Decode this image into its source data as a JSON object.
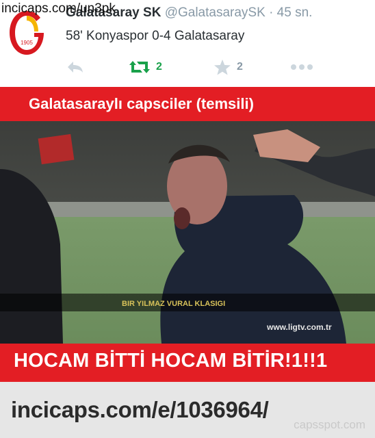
{
  "watermark": "incicaps.com/un3pk",
  "tweet": {
    "display_name": "Galatasaray SK",
    "handle": "@GalatasaraySK",
    "separator": "·",
    "time": "45 sn.",
    "text": "58' Konyaspor 0-4 Galatasaray",
    "retweet_count": "2",
    "favorite_count": "2",
    "avatar_year": "1905",
    "colors": {
      "retweet": "#19a14a",
      "icons": "#ccd6dd"
    }
  },
  "meme": {
    "top_caption": "Galatasaraylı capsciler (temsili)",
    "overlay_caption": "BIR YILMAZ VURAL KLASIGI",
    "broadcaster": "www.ligtv.com.tr",
    "bottom_caption": "HOCAM BİTTİ HOCAM BİTİR!1!!1",
    "banner_color": "#e31e24"
  },
  "footer": {
    "url": "incicaps.com/e/1036964/",
    "site": "capsspot.com"
  }
}
